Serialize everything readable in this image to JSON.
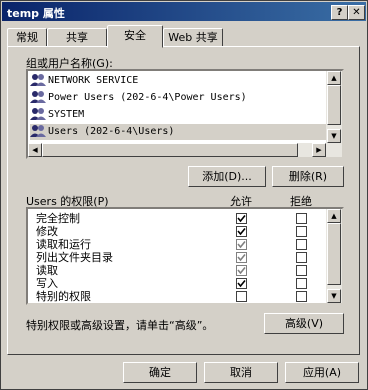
{
  "window": {
    "title": "temp 属性"
  },
  "titlebar": {
    "help_label": "?",
    "close_label": "✕"
  },
  "tabs": [
    {
      "label": "常规"
    },
    {
      "label": "共享"
    },
    {
      "label": "安全",
      "active": true
    },
    {
      "label": "Web 共享"
    }
  ],
  "users": {
    "label": "组或用户名称(G):",
    "items": [
      {
        "name": "NETWORK SERVICE"
      },
      {
        "name": "Power Users (202-6-4\\Power Users)"
      },
      {
        "name": "SYSTEM"
      },
      {
        "name": "Users (202-6-4\\Users)",
        "selected": true
      }
    ],
    "add_label": "添加(D)...",
    "remove_label": "删除(R)"
  },
  "permissions": {
    "label": "Users 的权限(P)",
    "allow_header": "允许",
    "deny_header": "拒绝",
    "items": [
      {
        "name": "完全控制",
        "allow": true,
        "allow_gray": false,
        "deny": false
      },
      {
        "name": "修改",
        "allow": true,
        "allow_gray": false,
        "deny": false
      },
      {
        "name": "读取和运行",
        "allow": true,
        "allow_gray": true,
        "deny": false
      },
      {
        "name": "列出文件夹目录",
        "allow": true,
        "allow_gray": true,
        "deny": false
      },
      {
        "name": "读取",
        "allow": true,
        "allow_gray": true,
        "deny": false
      },
      {
        "name": "写入",
        "allow": true,
        "allow_gray": false,
        "deny": false
      },
      {
        "name": "特别的权限",
        "allow": false,
        "allow_gray": false,
        "deny": false
      }
    ]
  },
  "advanced": {
    "hint": "特别权限或高级设置，请单击“高级”。",
    "button_label": "高级(V)"
  },
  "footer": {
    "ok_label": "确定",
    "cancel_label": "取消",
    "apply_label": "应用(A)"
  },
  "icons": {
    "user": "user-group-icon",
    "help": "help-icon",
    "close": "close-icon"
  }
}
